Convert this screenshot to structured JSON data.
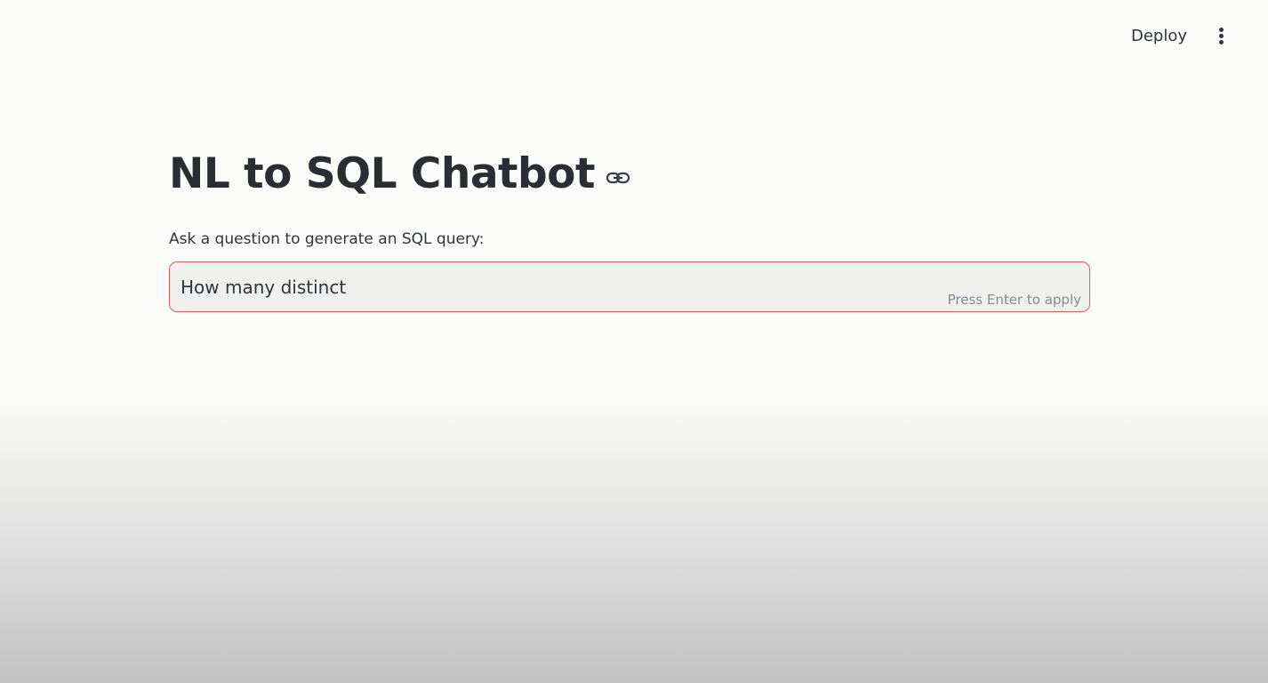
{
  "header": {
    "deploy_label": "Deploy",
    "menu_icon": "kebab-menu-icon"
  },
  "main": {
    "title": "NL to SQL Chatbot",
    "title_anchor_icon": "link-icon",
    "input": {
      "label": "Ask a question to generate an SQL query:",
      "value": "How many distinct",
      "hint": "Press Enter to apply"
    }
  },
  "colors": {
    "focus_border": "#e15a63",
    "text": "#31333f",
    "input_background": "#f0f1ef"
  }
}
